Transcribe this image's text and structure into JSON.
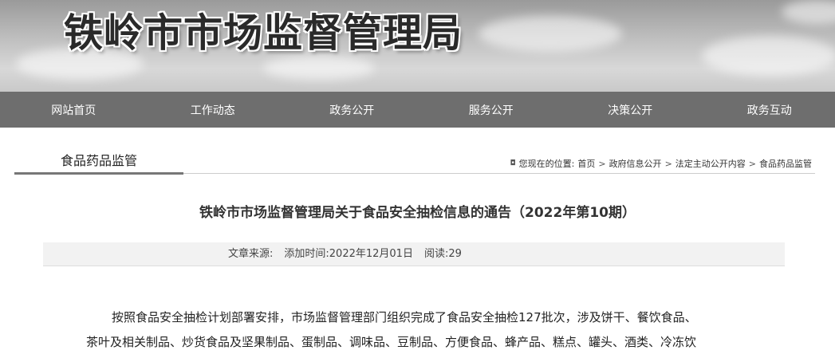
{
  "banner": {
    "title": "铁岭市市场监督管理局"
  },
  "nav": {
    "items": [
      "网站首页",
      "工作动态",
      "政务公开",
      "服务公开",
      "决策公开",
      "政务互动"
    ]
  },
  "section": {
    "title": "食品药品监管",
    "breadcrumb": {
      "prefix": "您现在的位置:",
      "items": [
        "首页",
        "政府信息公开",
        "法定主动公开内容",
        "食品药品监管"
      ],
      "separator": ">"
    }
  },
  "article": {
    "title": "铁岭市市场监督管理局关于食品安全抽检信息的通告（2022年第10期）",
    "meta": {
      "source": "文章来源:",
      "time": "添加时间:2022年12月01日",
      "reads": "阅读:29"
    },
    "body": {
      "line1": "按照食品安全抽检计划部署安排，市场监督管理部门组织完成了食品安全抽检127批次，涉及饼干、餐饮食品、",
      "line2": "茶叶及相关制品、炒货食品及坚果制品、蛋制品、调味品、豆制品、方便食品、蜂产品、糕点、罐头、酒类、冷冻饮"
    }
  },
  "colors": {
    "nav_bg": "#6e6e6e",
    "banner_text": "#2a2a2a",
    "meta_bg": "#f2f2f2"
  }
}
